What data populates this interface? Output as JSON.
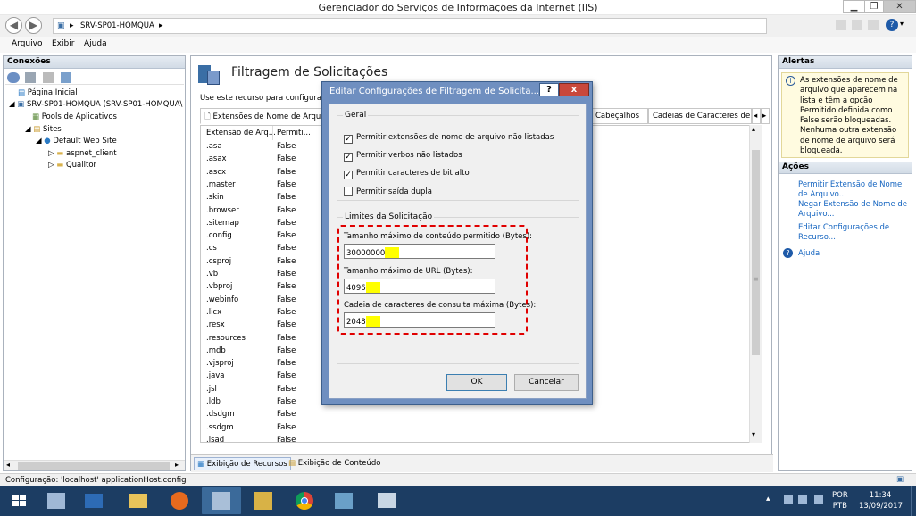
{
  "window": {
    "title": "Gerenciador do Serviços de Informações da Internet (IIS)"
  },
  "address": {
    "path": "SRV-SP01-HOMQUA"
  },
  "menu": [
    "Arquivo",
    "Exibir",
    "Ajuda"
  ],
  "left": {
    "header": "Conexões",
    "tree": [
      "Página Inicial",
      "SRV-SP01-HOMQUA (SRV-SP01-HOMQUA\\",
      "Pools de Aplicativos",
      "Sites",
      "Default Web Site",
      "aspnet_client",
      "Qualitor"
    ]
  },
  "center": {
    "title": "Filtragem de Solicitações",
    "description": "Use este recurso para configurar re",
    "tabs": [
      "Extensões de Nome de Arquivo",
      "Cabeçalhos",
      "Cadeias de Caracteres de C"
    ],
    "columns": [
      "Extensão de Arq...",
      "Permiti..."
    ],
    "rows": [
      [
        ".asa",
        "False"
      ],
      [
        ".asax",
        "False"
      ],
      [
        ".ascx",
        "False"
      ],
      [
        ".master",
        "False"
      ],
      [
        ".skin",
        "False"
      ],
      [
        ".browser",
        "False"
      ],
      [
        ".sitemap",
        "False"
      ],
      [
        ".config",
        "False"
      ],
      [
        ".cs",
        "False"
      ],
      [
        ".csproj",
        "False"
      ],
      [
        ".vb",
        "False"
      ],
      [
        ".vbproj",
        "False"
      ],
      [
        ".webinfo",
        "False"
      ],
      [
        ".licx",
        "False"
      ],
      [
        ".resx",
        "False"
      ],
      [
        ".resources",
        "False"
      ],
      [
        ".mdb",
        "False"
      ],
      [
        ".vjsproj",
        "False"
      ],
      [
        ".java",
        "False"
      ],
      [
        ".jsl",
        "False"
      ],
      [
        ".ldb",
        "False"
      ],
      [
        ".dsdgm",
        "False"
      ],
      [
        ".ssdgm",
        "False"
      ],
      [
        ".lsad",
        "False"
      ]
    ],
    "view_tabs": [
      "Exibição de Recursos",
      "Exibição de Conteúdo"
    ]
  },
  "right": {
    "alerts_header": "Alertas",
    "alert_text": "As extensões de nome de arquivo que aparecem na lista e têm a opção Permitido definida como False serão bloqueadas. Nenhuma outra extensão de nome de arquivo será bloqueada.",
    "actions_header": "Ações",
    "actions": [
      "Permitir Extensão de Nome de Arquivo...",
      "Negar Extensão de Nome de Arquivo...",
      "Editar Configurações de Recurso...",
      "Ajuda"
    ]
  },
  "status": {
    "text": "Configuração: 'localhost' applicationHost.config"
  },
  "taskbar": {
    "lang1": "POR",
    "lang2": "PTB",
    "time": "11:34",
    "date": "13/09/2017"
  },
  "dialog": {
    "title": "Editar Configurações de Filtragem de Solicita...",
    "help": "?",
    "close": "x",
    "group1": "Geral",
    "checks": [
      {
        "label": "Permitir extensões de nome de arquivo não listadas",
        "checked": true
      },
      {
        "label": "Permitir verbos não listados",
        "checked": true
      },
      {
        "label": "Permitir caracteres de bit alto",
        "checked": true
      },
      {
        "label": "Permitir saída dupla",
        "checked": false
      }
    ],
    "group2": "Limites da Solicitação",
    "fields": [
      {
        "label": "Tamanho máximo de conteúdo permitido (Bytes):",
        "value": "30000000"
      },
      {
        "label": "Tamanho máximo de URL (Bytes):",
        "value": "4096"
      },
      {
        "label": "Cadeia de caracteres de consulta máxima (Bytes):",
        "value": "2048"
      }
    ],
    "ok": "OK",
    "cancel": "Cancelar"
  },
  "colors": {
    "accent": "#1565c0",
    "highlight": "#ffff00",
    "annotation": "#e00000",
    "dialog_frame": "#6f8fc0",
    "taskbar": "#1c3d63"
  }
}
